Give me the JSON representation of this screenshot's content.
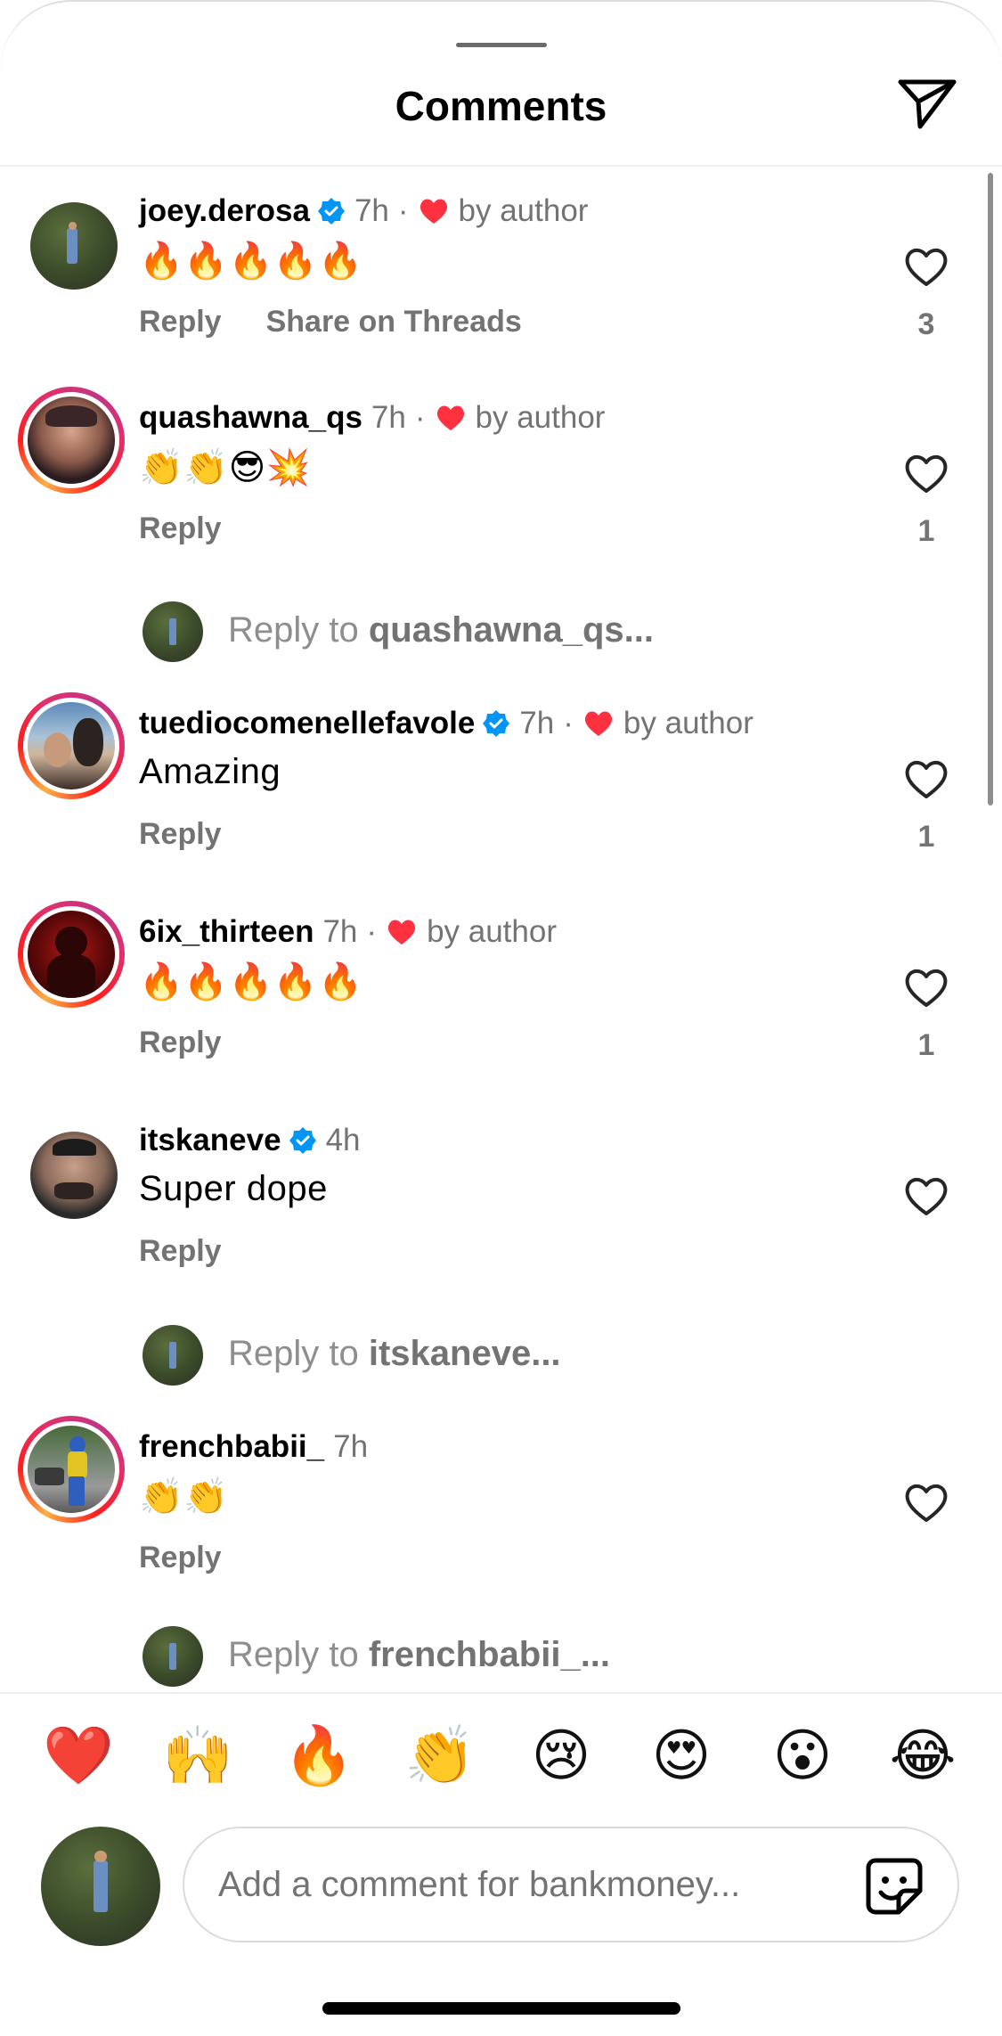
{
  "header": {
    "title": "Comments",
    "send_icon": "paper-plane-icon"
  },
  "comments": [
    {
      "username": "joey.derosa",
      "verified": true,
      "time": "7h",
      "liked_by_author": true,
      "by_author": "by author",
      "text": "🔥🔥🔥🔥🔥",
      "reply_label": "Reply",
      "share_label": "Share on Threads",
      "likes": "3"
    },
    {
      "username": "quashawna_qs",
      "verified": false,
      "time": "7h",
      "liked_by_author": true,
      "by_author": "by author",
      "text": "👏👏😎💥",
      "reply_label": "Reply",
      "likes": "1"
    },
    {
      "username": "tuediocomenellefavole",
      "verified": true,
      "time": "7h",
      "liked_by_author": true,
      "by_author": "by author",
      "text": "Amazing",
      "reply_label": "Reply",
      "likes": "1"
    },
    {
      "username": "6ix_thirteen",
      "verified": false,
      "time": "7h",
      "liked_by_author": true,
      "by_author": "by author",
      "text": "🔥🔥🔥🔥🔥",
      "reply_label": "Reply",
      "likes": "1"
    },
    {
      "username": "itskaneve",
      "verified": true,
      "time": "4h",
      "liked_by_author": false,
      "text": "Super dope",
      "reply_label": "Reply"
    },
    {
      "username": "frenchbabii_",
      "verified": false,
      "time": "7h",
      "liked_by_author": false,
      "text": "👏👏",
      "reply_label": "Reply"
    }
  ],
  "reply_prompts": [
    {
      "prefix": "Reply to ",
      "target": "quashawna_qs..."
    },
    {
      "prefix": "Reply to ",
      "target": "itskaneve..."
    },
    {
      "prefix": "Reply to ",
      "target": "frenchbabii_..."
    }
  ],
  "quick_emojis": [
    "❤️",
    "🙌",
    "🔥",
    "👏",
    "😢",
    "😍",
    "😮",
    "😂"
  ],
  "composer": {
    "placeholder": "Add a comment for bankmoney...",
    "sticker_icon": "sticker-icon"
  },
  "colors": {
    "accent_heart": "#ff3040",
    "verified_blue": "#0095f6",
    "muted_text": "#737373"
  }
}
